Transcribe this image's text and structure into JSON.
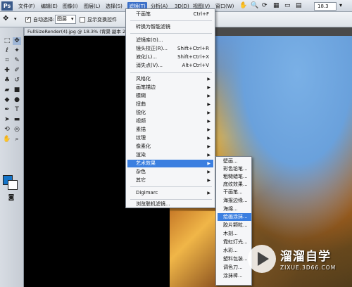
{
  "menubar": {
    "logo": "Ps",
    "items": [
      "文件(F)",
      "编辑(E)",
      "图像(I)",
      "图层(L)",
      "选择(S)",
      "滤镜(T)",
      "分析(A)",
      "3D(D)",
      "视图(V)",
      "窗口(W)"
    ],
    "zoom": "18.3"
  },
  "options": {
    "auto_select_label": "自动选择:",
    "auto_select_value": "图层",
    "show_transform_label": "显示变换控件"
  },
  "document": {
    "tab_title": "FullSizeRender(4).jpg @ 18.3% (背景 副本 2"
  },
  "filter_menu": {
    "items": [
      {
        "label": "干画笔",
        "shortcut": "Ctrl+F"
      },
      {
        "label": "转换为智能滤镜"
      },
      {
        "label": "滤镜库(G)..."
      },
      {
        "label": "镜头校正(R)...",
        "shortcut": "Shift+Ctrl+R"
      },
      {
        "label": "液化(L)...",
        "shortcut": "Shift+Ctrl+X"
      },
      {
        "label": "消失点(V)...",
        "shortcut": "Alt+Ctrl+V"
      },
      {
        "label": "风格化"
      },
      {
        "label": "画笔描边"
      },
      {
        "label": "模糊"
      },
      {
        "label": "扭曲"
      },
      {
        "label": "锐化"
      },
      {
        "label": "视频"
      },
      {
        "label": "素描"
      },
      {
        "label": "纹理"
      },
      {
        "label": "像素化"
      },
      {
        "label": "渲染"
      },
      {
        "label": "艺术效果"
      },
      {
        "label": "杂色"
      },
      {
        "label": "其它"
      },
      {
        "label": "Digimarc"
      },
      {
        "label": "浏览联机滤镜..."
      }
    ]
  },
  "artistic_submenu": {
    "items": [
      "壁画...",
      "彩色铅笔...",
      "粗糙蜡笔...",
      "底纹效果...",
      "干画笔...",
      "海报边缘...",
      "海绵...",
      "绘画涂抹...",
      "胶片颗粒...",
      "木刻...",
      "霓虹灯光...",
      "水彩...",
      "塑料包装...",
      "调色刀...",
      "涂抹棒..."
    ]
  },
  "watermark": {
    "title": "溜溜自学",
    "url": "ZIXUE.3D66.COM"
  },
  "colors": {
    "highlight": "#3b7fe0",
    "foreground_swatch": "#1474c8",
    "background_swatch": "#ffffff"
  }
}
